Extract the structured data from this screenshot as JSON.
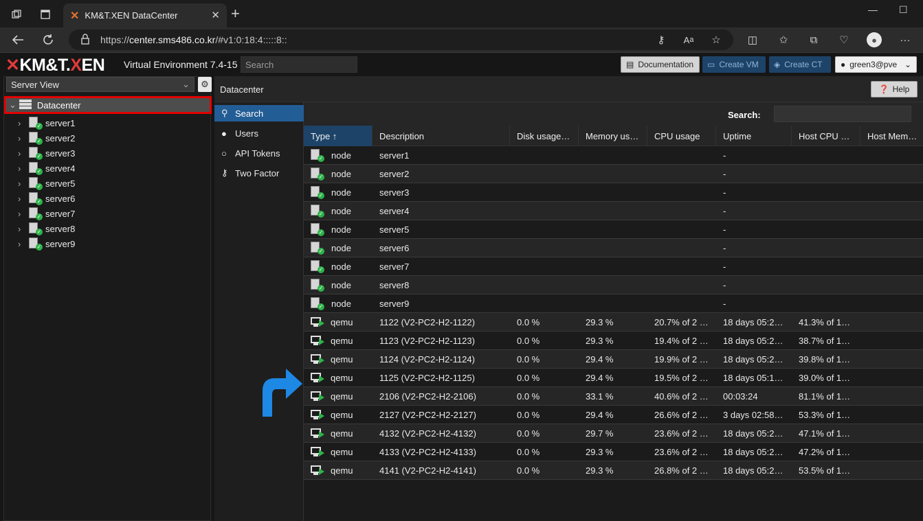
{
  "browser": {
    "tab_title": "KM&T.XEN DataCenter",
    "tab_close": "✕",
    "new_tab": "+",
    "url_prefix": "https://",
    "url_host": "center.sms486.co.kr",
    "url_rest": "/#v1:0:18:4:::::8::"
  },
  "header": {
    "logo_x": "✕",
    "logo_km": "KM&T.",
    "logo_x2": "X",
    "logo_en": "EN",
    "version": "Virtual Environment 7.4-15",
    "search_placeholder": "Search",
    "doc_button": "Documentation",
    "create_vm": "Create VM",
    "create_ct": "Create CT",
    "user": "green3@pve"
  },
  "left": {
    "view_select": "Server View",
    "datacenter": "Datacenter",
    "servers": [
      "server1",
      "server2",
      "server3",
      "server4",
      "server5",
      "server6",
      "server7",
      "server8",
      "server9"
    ]
  },
  "main": {
    "title": "Datacenter",
    "help": "Help",
    "nav": [
      "Search",
      "Users",
      "API Tokens",
      "Two Factor"
    ],
    "search_label": "Search:",
    "columns": [
      "Type ↑",
      "Description",
      "Disk usage…",
      "Memory us…",
      "CPU usage",
      "Uptime",
      "Host CPU …",
      "Host Mem…"
    ],
    "rows": [
      {
        "type": "node",
        "desc": "server1",
        "disk": "",
        "mem": "",
        "cpu": "",
        "uptime": "-",
        "hcpu": "",
        "hmem": ""
      },
      {
        "type": "node",
        "desc": "server2",
        "disk": "",
        "mem": "",
        "cpu": "",
        "uptime": "-",
        "hcpu": "",
        "hmem": ""
      },
      {
        "type": "node",
        "desc": "server3",
        "disk": "",
        "mem": "",
        "cpu": "",
        "uptime": "-",
        "hcpu": "",
        "hmem": ""
      },
      {
        "type": "node",
        "desc": "server4",
        "disk": "",
        "mem": "",
        "cpu": "",
        "uptime": "-",
        "hcpu": "",
        "hmem": ""
      },
      {
        "type": "node",
        "desc": "server5",
        "disk": "",
        "mem": "",
        "cpu": "",
        "uptime": "-",
        "hcpu": "",
        "hmem": ""
      },
      {
        "type": "node",
        "desc": "server6",
        "disk": "",
        "mem": "",
        "cpu": "",
        "uptime": "-",
        "hcpu": "",
        "hmem": ""
      },
      {
        "type": "node",
        "desc": "server7",
        "disk": "",
        "mem": "",
        "cpu": "",
        "uptime": "-",
        "hcpu": "",
        "hmem": ""
      },
      {
        "type": "node",
        "desc": "server8",
        "disk": "",
        "mem": "",
        "cpu": "",
        "uptime": "-",
        "hcpu": "",
        "hmem": ""
      },
      {
        "type": "node",
        "desc": "server9",
        "disk": "",
        "mem": "",
        "cpu": "",
        "uptime": "-",
        "hcpu": "",
        "hmem": ""
      },
      {
        "type": "qemu",
        "desc": "1122 (V2-PC2-H2-1122)",
        "disk": "0.0 %",
        "mem": "29.3 %",
        "cpu": "20.7% of 2 …",
        "uptime": "18 days 05:2…",
        "hcpu": "41.3% of 1…",
        "hmem": ""
      },
      {
        "type": "qemu",
        "desc": "1123 (V2-PC2-H2-1123)",
        "disk": "0.0 %",
        "mem": "29.3 %",
        "cpu": "19.4% of 2 …",
        "uptime": "18 days 05:2…",
        "hcpu": "38.7% of 1…",
        "hmem": ""
      },
      {
        "type": "qemu",
        "desc": "1124 (V2-PC2-H2-1124)",
        "disk": "0.0 %",
        "mem": "29.4 %",
        "cpu": "19.9% of 2 …",
        "uptime": "18 days 05:2…",
        "hcpu": "39.8% of 1…",
        "hmem": ""
      },
      {
        "type": "qemu",
        "desc": "1125 (V2-PC2-H2-1125)",
        "disk": "0.0 %",
        "mem": "29.4 %",
        "cpu": "19.5% of 2 …",
        "uptime": "18 days 05:1…",
        "hcpu": "39.0% of 1…",
        "hmem": ""
      },
      {
        "type": "qemu",
        "desc": "2106 (V2-PC2-H2-2106)",
        "disk": "0.0 %",
        "mem": "33.1 %",
        "cpu": "40.6% of 2 …",
        "uptime": "00:03:24",
        "hcpu": "81.1% of 1…",
        "hmem": ""
      },
      {
        "type": "qemu",
        "desc": "2127 (V2-PC2-H2-2127)",
        "disk": "0.0 %",
        "mem": "29.4 %",
        "cpu": "26.6% of 2 …",
        "uptime": "3 days 02:58…",
        "hcpu": "53.3% of 1…",
        "hmem": ""
      },
      {
        "type": "qemu",
        "desc": "4132 (V2-PC2-H2-4132)",
        "disk": "0.0 %",
        "mem": "29.7 %",
        "cpu": "23.6% of 2 …",
        "uptime": "18 days 05:2…",
        "hcpu": "47.1% of 1…",
        "hmem": ""
      },
      {
        "type": "qemu",
        "desc": "4133 (V2-PC2-H2-4133)",
        "disk": "0.0 %",
        "mem": "29.3 %",
        "cpu": "23.6% of 2 …",
        "uptime": "18 days 05:2…",
        "hcpu": "47.2% of 1…",
        "hmem": ""
      },
      {
        "type": "qemu",
        "desc": "4141 (V2-PC2-H2-4141)",
        "disk": "0.0 %",
        "mem": "29.3 %",
        "cpu": "26.8% of 2 …",
        "uptime": "18 days 05:2…",
        "hcpu": "53.5% of 1…",
        "hmem": ""
      }
    ]
  },
  "colors": {
    "accent": "#235d96",
    "highlight_border": "#e30000",
    "ok": "#2eb34a",
    "arrow": "#1e88e5"
  }
}
